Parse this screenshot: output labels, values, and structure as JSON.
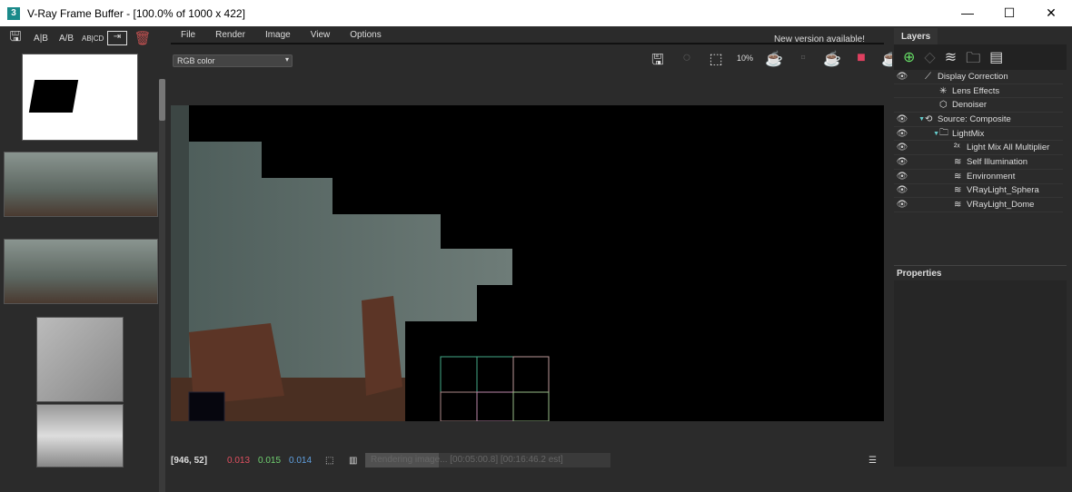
{
  "window": {
    "title": "V-Ray Frame Buffer - [100.0% of 1000 x 422]",
    "logo": "3",
    "minimize": "—",
    "maximize": "☐",
    "close": "✕"
  },
  "history_toolbar": {
    "icons": [
      "save-history-icon",
      "ab-compare-icon",
      "ab-diagonal-icon",
      "abcd-compare-icon",
      "load-icon",
      "trash-icon"
    ],
    "ab": "A|B",
    "ab_diag": "A/B",
    "abcd": "AB|CD"
  },
  "menu": {
    "items": [
      "File",
      "Render",
      "Image",
      "View",
      "Options"
    ],
    "new_version": "New version available!"
  },
  "channel": {
    "selected": "RGB color"
  },
  "view_toolbar": {
    "zoom_label": "10%"
  },
  "status": {
    "coords": "[946, 52]",
    "r": "0.013",
    "g": "0.015",
    "b": "0.014",
    "progress_text": "Rendering image... [00:05:00.8] [00:16:46.2 est]",
    "progress_fraction": 0.3
  },
  "colors": {
    "r": "#e05060",
    "g": "#70d070",
    "b": "#60a0e0"
  },
  "layers": {
    "tab": "Layers",
    "items": [
      {
        "label": "Display Correction",
        "eye": true,
        "indent": 1,
        "icon": "curve-icon"
      },
      {
        "label": "Lens Effects",
        "eye": false,
        "indent": 2,
        "icon": "lens-icon"
      },
      {
        "label": "Denoiser",
        "eye": false,
        "indent": 2,
        "icon": "cube-icon"
      },
      {
        "label": "Source: Composite",
        "eye": true,
        "indent": 1,
        "icon": "composite-icon"
      },
      {
        "label": "LightMix",
        "eye": true,
        "indent": 2,
        "icon": "folder-icon"
      },
      {
        "label": "Light Mix All Multiplier",
        "eye": true,
        "indent": 3,
        "icon": "multiplier-icon"
      },
      {
        "label": "Self Illumination",
        "eye": true,
        "indent": 3,
        "icon": "layers-icon"
      },
      {
        "label": "Environment",
        "eye": true,
        "indent": 3,
        "icon": "layers-icon"
      },
      {
        "label": "VRayLight_Sphera",
        "eye": true,
        "indent": 3,
        "icon": "layers-icon"
      },
      {
        "label": "VRayLight_Dome",
        "eye": true,
        "indent": 3,
        "icon": "layers-icon"
      }
    ]
  },
  "properties": {
    "title": "Properties"
  }
}
